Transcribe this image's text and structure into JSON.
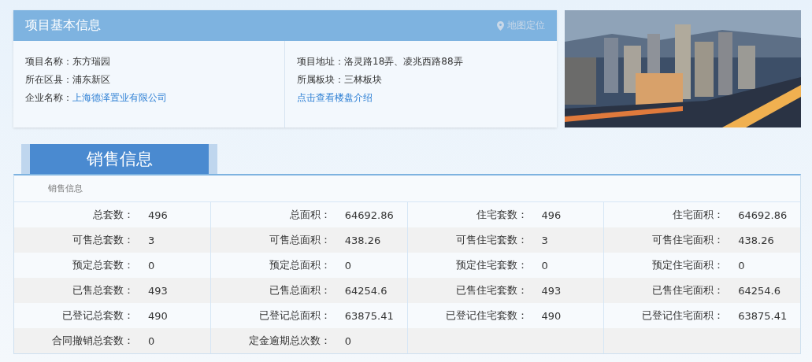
{
  "project_info": {
    "title": "项目基本信息",
    "map_link": "地图定位",
    "left_fields": [
      {
        "label": "项目名称：",
        "value": "东方瑞园",
        "kind": "text"
      },
      {
        "label": "所在区县：",
        "value": "浦东新区",
        "kind": "text"
      },
      {
        "label": "企业名称：",
        "value": "上海德泽置业有限公司",
        "kind": "link"
      }
    ],
    "right_fields": [
      {
        "label": "项目地址：",
        "value": "洛灵路18弄、凌兆西路88弄",
        "kind": "text"
      },
      {
        "label": "所属板块：",
        "value": "三林板块",
        "kind": "text"
      }
    ],
    "intro_link": "点击查看楼盘介绍"
  },
  "sales": {
    "tab": "销售信息",
    "caption": "销售信息",
    "rows": [
      [
        {
          "label": "总套数：",
          "value": "496"
        },
        {
          "label": "总面积：",
          "value": "64692.86"
        },
        {
          "label": "住宅套数：",
          "value": "496"
        },
        {
          "label": "住宅面积：",
          "value": "64692.86"
        }
      ],
      [
        {
          "label": "可售总套数：",
          "value": "3"
        },
        {
          "label": "可售总面积：",
          "value": "438.26"
        },
        {
          "label": "可售住宅套数：",
          "value": "3"
        },
        {
          "label": "可售住宅面积：",
          "value": "438.26"
        }
      ],
      [
        {
          "label": "预定总套数：",
          "value": "0"
        },
        {
          "label": "预定总面积：",
          "value": "0"
        },
        {
          "label": "预定住宅套数：",
          "value": "0"
        },
        {
          "label": "预定住宅面积：",
          "value": "0"
        }
      ],
      [
        {
          "label": "已售总套数：",
          "value": "493"
        },
        {
          "label": "已售总面积：",
          "value": "64254.6"
        },
        {
          "label": "已售住宅套数：",
          "value": "493"
        },
        {
          "label": "已售住宅面积：",
          "value": "64254.6"
        }
      ],
      [
        {
          "label": "已登记总套数：",
          "value": "490"
        },
        {
          "label": "已登记总面积：",
          "value": "63875.41"
        },
        {
          "label": "已登记住宅套数：",
          "value": "490"
        },
        {
          "label": "已登记住宅面积：",
          "value": "63875.41"
        }
      ],
      [
        {
          "label": "合同撤销总套数：",
          "value": "0"
        },
        {
          "label": "定金逾期总次数：",
          "value": "0"
        }
      ]
    ]
  }
}
